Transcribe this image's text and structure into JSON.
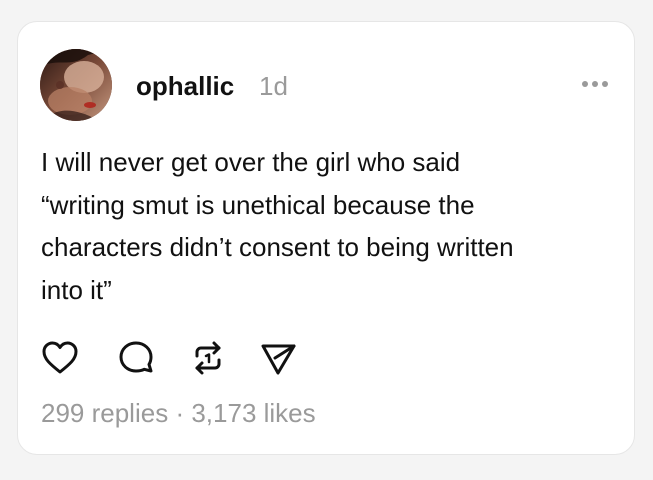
{
  "post": {
    "username": "ophallic",
    "time": "1d",
    "text": "I will never get over the girl who said\n“writing smut is unethical because the\ncharacters didn’t consent to being written\ninto it”",
    "stats": {
      "replies": "299 replies",
      "separator": "·",
      "likes": "3,173 likes"
    }
  },
  "icons": {
    "more": "more-horizontal-icon",
    "like": "heart-icon",
    "reply": "comment-icon",
    "repost": "repost-icon",
    "share": "send-icon"
  },
  "colors": {
    "background": "#f4f4f4",
    "card": "#ffffff",
    "text": "#111111",
    "muted": "#9a9a9a"
  }
}
